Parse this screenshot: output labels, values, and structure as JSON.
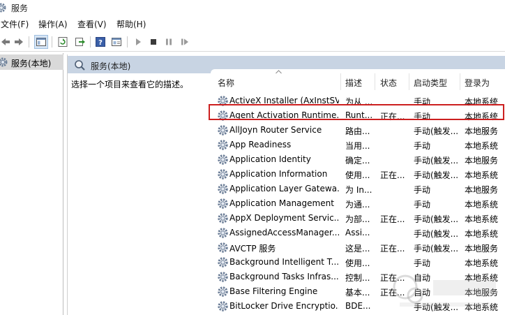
{
  "window": {
    "title": "服务"
  },
  "menu": {
    "items": [
      "文件(F)",
      "操作(A)",
      "查看(V)",
      "帮助(H)"
    ]
  },
  "tree": {
    "selected_label": "服务(本地)"
  },
  "content": {
    "header_title": "服务(本地)",
    "description_prompt": "选择一个项目来查看它的描述。"
  },
  "columns": {
    "name": "名称",
    "description": "描述",
    "status": "状态",
    "startup": "启动类型",
    "logon": "登录为"
  },
  "services": [
    {
      "name": "ActiveX Installer (AxInstSV)",
      "description": "为从 ...",
      "status": "",
      "startup": "手动",
      "logon": "本地系统"
    },
    {
      "name": "Agent Activation Runtime...",
      "description": "Runt...",
      "status": "正在...",
      "startup": "手动",
      "logon": "本地系统"
    },
    {
      "name": "AllJoyn Router Service",
      "description": "路由...",
      "status": "",
      "startup": "手动(触发...",
      "logon": "本地服务"
    },
    {
      "name": "App Readiness",
      "description": "当用...",
      "status": "",
      "startup": "手动",
      "logon": "本地系统"
    },
    {
      "name": "Application Identity",
      "description": "确定...",
      "status": "",
      "startup": "手动(触发...",
      "logon": "本地服务"
    },
    {
      "name": "Application Information",
      "description": "使用...",
      "status": "正在...",
      "startup": "手动(触发...",
      "logon": "本地系统"
    },
    {
      "name": "Application Layer Gatewa...",
      "description": "为 In...",
      "status": "",
      "startup": "手动",
      "logon": "本地服务"
    },
    {
      "name": "Application Management",
      "description": "为通...",
      "status": "",
      "startup": "手动",
      "logon": "本地系统"
    },
    {
      "name": "AppX Deployment Servic...",
      "description": "为部...",
      "status": "正在...",
      "startup": "手动(触发...",
      "logon": "本地系统"
    },
    {
      "name": "AssignedAccessManager...",
      "description": "Assi...",
      "status": "",
      "startup": "手动(触发...",
      "logon": "本地系统"
    },
    {
      "name": "AVCTP 服务",
      "description": "这是...",
      "status": "正在...",
      "startup": "手动(触发...",
      "logon": "本地服务"
    },
    {
      "name": "Background Intelligent T...",
      "description": "使用...",
      "status": "",
      "startup": "手动",
      "logon": "本地系统"
    },
    {
      "name": "Background Tasks Infras...",
      "description": "控制...",
      "status": "正在...",
      "startup": "自动",
      "logon": "本地系统"
    },
    {
      "name": "Base Filtering Engine",
      "description": "基本...",
      "status": "正在...",
      "startup": "自动",
      "logon": "本地服务"
    },
    {
      "name": "BitLocker Drive Encryptio...",
      "description": "BDE...",
      "status": "",
      "startup": "手动(触发...",
      "logon": "本地系统"
    }
  ],
  "highlighted_row": 1,
  "colors": {
    "header_bg": "#c8d4e3",
    "highlight_border": "#cc1f1f",
    "tree_selected_bg": "#d9d9d9"
  },
  "icons": [
    "gear-icon",
    "back-icon",
    "forward-icon",
    "console-tree-icon",
    "refresh-icon",
    "export-icon",
    "help-icon",
    "properties-icon",
    "play-icon",
    "stop-icon",
    "pause-icon",
    "restart-icon"
  ]
}
